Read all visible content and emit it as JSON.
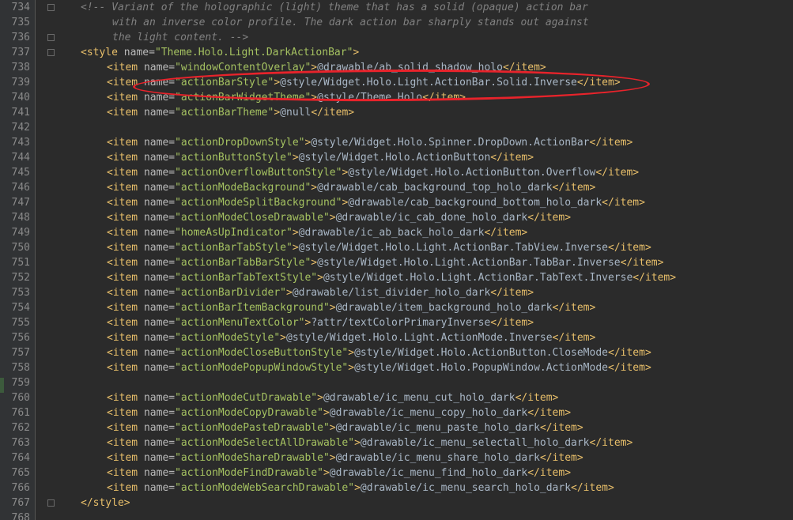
{
  "editor": {
    "annotation_color": "#e8232b",
    "lines": [
      {
        "no": "734",
        "indent": "comment",
        "fold": true,
        "segments": [
          {
            "t": "c",
            "v": "<!-- Variant of the holographic (light) theme that has a solid (opaque) action bar"
          }
        ]
      },
      {
        "no": "735",
        "indent": "comment2",
        "fold": false,
        "segments": [
          {
            "t": "c",
            "v": "with an inverse color profile. The dark action bar sharply stands out against"
          }
        ]
      },
      {
        "no": "736",
        "indent": "comment2",
        "fold": true,
        "segments": [
          {
            "t": "c",
            "v": "the light content. -->"
          }
        ]
      },
      {
        "no": "737",
        "indent": "style",
        "fold": true,
        "segments": [
          {
            "t": "tag",
            "v": "<style"
          },
          {
            "t": "attr",
            "v": " name="
          },
          {
            "t": "val",
            "v": "\"Theme.Holo.Light.DarkActionBar\""
          },
          {
            "t": "tag",
            "v": ">"
          }
        ]
      },
      {
        "no": "738",
        "indent": "item",
        "fold": false,
        "segments": [
          {
            "t": "tag",
            "v": "<item"
          },
          {
            "t": "attr",
            "v": " name="
          },
          {
            "t": "val",
            "v": "\"windowContentOverlay\""
          },
          {
            "t": "tag",
            "v": ">"
          },
          {
            "t": "txt",
            "v": "@drawable/ab_solid_shadow_holo"
          },
          {
            "t": "tag",
            "v": "</item>"
          }
        ]
      },
      {
        "no": "739",
        "indent": "item",
        "fold": false,
        "segments": [
          {
            "t": "tag",
            "v": "<item"
          },
          {
            "t": "attr",
            "v": " name="
          },
          {
            "t": "val",
            "v": "\"actionBarStyle\""
          },
          {
            "t": "tag",
            "v": ">"
          },
          {
            "t": "txt",
            "v": "@style/Widget.Holo.Light.ActionBar.Solid.Inverse"
          },
          {
            "t": "tag",
            "v": "</item>"
          }
        ]
      },
      {
        "no": "740",
        "indent": "item",
        "fold": false,
        "segments": [
          {
            "t": "tag",
            "v": "<item"
          },
          {
            "t": "attr",
            "v": " name="
          },
          {
            "t": "val",
            "v": "\"actionBarWidgetTheme\""
          },
          {
            "t": "tag",
            "v": ">"
          },
          {
            "t": "txt",
            "v": "@style/Theme.Holo"
          },
          {
            "t": "tag",
            "v": "</item>"
          }
        ]
      },
      {
        "no": "741",
        "indent": "item",
        "fold": false,
        "segments": [
          {
            "t": "tag",
            "v": "<item"
          },
          {
            "t": "attr",
            "v": " name="
          },
          {
            "t": "val",
            "v": "\"actionBarTheme\""
          },
          {
            "t": "tag",
            "v": ">"
          },
          {
            "t": "txt",
            "v": "@null"
          },
          {
            "t": "tag",
            "v": "</item>"
          }
        ]
      },
      {
        "no": "742",
        "indent": "item",
        "fold": false,
        "segments": []
      },
      {
        "no": "743",
        "indent": "item",
        "fold": false,
        "segments": [
          {
            "t": "tag",
            "v": "<item"
          },
          {
            "t": "attr",
            "v": " name="
          },
          {
            "t": "val",
            "v": "\"actionDropDownStyle\""
          },
          {
            "t": "tag",
            "v": ">"
          },
          {
            "t": "txt",
            "v": "@style/Widget.Holo.Spinner.DropDown.ActionBar"
          },
          {
            "t": "tag",
            "v": "</item>"
          }
        ]
      },
      {
        "no": "744",
        "indent": "item",
        "fold": false,
        "segments": [
          {
            "t": "tag",
            "v": "<item"
          },
          {
            "t": "attr",
            "v": " name="
          },
          {
            "t": "val",
            "v": "\"actionButtonStyle\""
          },
          {
            "t": "tag",
            "v": ">"
          },
          {
            "t": "txt",
            "v": "@style/Widget.Holo.ActionButton"
          },
          {
            "t": "tag",
            "v": "</item>"
          }
        ]
      },
      {
        "no": "745",
        "indent": "item",
        "fold": false,
        "segments": [
          {
            "t": "tag",
            "v": "<item"
          },
          {
            "t": "attr",
            "v": " name="
          },
          {
            "t": "val",
            "v": "\"actionOverflowButtonStyle\""
          },
          {
            "t": "tag",
            "v": ">"
          },
          {
            "t": "txt",
            "v": "@style/Widget.Holo.ActionButton.Overflow"
          },
          {
            "t": "tag",
            "v": "</item>"
          }
        ]
      },
      {
        "no": "746",
        "indent": "item",
        "fold": false,
        "segments": [
          {
            "t": "tag",
            "v": "<item"
          },
          {
            "t": "attr",
            "v": " name="
          },
          {
            "t": "val",
            "v": "\"actionModeBackground\""
          },
          {
            "t": "tag",
            "v": ">"
          },
          {
            "t": "txt",
            "v": "@drawable/cab_background_top_holo_dark"
          },
          {
            "t": "tag",
            "v": "</item>"
          }
        ]
      },
      {
        "no": "747",
        "indent": "item",
        "fold": false,
        "segments": [
          {
            "t": "tag",
            "v": "<item"
          },
          {
            "t": "attr",
            "v": " name="
          },
          {
            "t": "val",
            "v": "\"actionModeSplitBackground\""
          },
          {
            "t": "tag",
            "v": ">"
          },
          {
            "t": "txt",
            "v": "@drawable/cab_background_bottom_holo_dark"
          },
          {
            "t": "tag",
            "v": "</item>"
          }
        ]
      },
      {
        "no": "748",
        "indent": "item",
        "fold": false,
        "segments": [
          {
            "t": "tag",
            "v": "<item"
          },
          {
            "t": "attr",
            "v": " name="
          },
          {
            "t": "val",
            "v": "\"actionModeCloseDrawable\""
          },
          {
            "t": "tag",
            "v": ">"
          },
          {
            "t": "txt",
            "v": "@drawable/ic_cab_done_holo_dark"
          },
          {
            "t": "tag",
            "v": "</item>"
          }
        ]
      },
      {
        "no": "749",
        "indent": "item",
        "fold": false,
        "segments": [
          {
            "t": "tag",
            "v": "<item"
          },
          {
            "t": "attr",
            "v": " name="
          },
          {
            "t": "val",
            "v": "\"homeAsUpIndicator\""
          },
          {
            "t": "tag",
            "v": ">"
          },
          {
            "t": "txt",
            "v": "@drawable/ic_ab_back_holo_dark"
          },
          {
            "t": "tag",
            "v": "</item>"
          }
        ]
      },
      {
        "no": "750",
        "indent": "item",
        "fold": false,
        "segments": [
          {
            "t": "tag",
            "v": "<item"
          },
          {
            "t": "attr",
            "v": " name="
          },
          {
            "t": "val",
            "v": "\"actionBarTabStyle\""
          },
          {
            "t": "tag",
            "v": ">"
          },
          {
            "t": "txt",
            "v": "@style/Widget.Holo.Light.ActionBar.TabView.Inverse"
          },
          {
            "t": "tag",
            "v": "</item>"
          }
        ]
      },
      {
        "no": "751",
        "indent": "item",
        "fold": false,
        "segments": [
          {
            "t": "tag",
            "v": "<item"
          },
          {
            "t": "attr",
            "v": " name="
          },
          {
            "t": "val",
            "v": "\"actionBarTabBarStyle\""
          },
          {
            "t": "tag",
            "v": ">"
          },
          {
            "t": "txt",
            "v": "@style/Widget.Holo.Light.ActionBar.TabBar.Inverse"
          },
          {
            "t": "tag",
            "v": "</item>"
          }
        ]
      },
      {
        "no": "752",
        "indent": "item",
        "fold": false,
        "segments": [
          {
            "t": "tag",
            "v": "<item"
          },
          {
            "t": "attr",
            "v": " name="
          },
          {
            "t": "val",
            "v": "\"actionBarTabTextStyle\""
          },
          {
            "t": "tag",
            "v": ">"
          },
          {
            "t": "txt",
            "v": "@style/Widget.Holo.Light.ActionBar.TabText.Inverse"
          },
          {
            "t": "tag",
            "v": "</item>"
          }
        ]
      },
      {
        "no": "753",
        "indent": "item",
        "fold": false,
        "segments": [
          {
            "t": "tag",
            "v": "<item"
          },
          {
            "t": "attr",
            "v": " name="
          },
          {
            "t": "val",
            "v": "\"actionBarDivider\""
          },
          {
            "t": "tag",
            "v": ">"
          },
          {
            "t": "txt",
            "v": "@drawable/list_divider_holo_dark"
          },
          {
            "t": "tag",
            "v": "</item>"
          }
        ]
      },
      {
        "no": "754",
        "indent": "item",
        "fold": false,
        "segments": [
          {
            "t": "tag",
            "v": "<item"
          },
          {
            "t": "attr",
            "v": " name="
          },
          {
            "t": "val",
            "v": "\"actionBarItemBackground\""
          },
          {
            "t": "tag",
            "v": ">"
          },
          {
            "t": "txt",
            "v": "@drawable/item_background_holo_dark"
          },
          {
            "t": "tag",
            "v": "</item>"
          }
        ]
      },
      {
        "no": "755",
        "indent": "item",
        "fold": false,
        "segments": [
          {
            "t": "tag",
            "v": "<item"
          },
          {
            "t": "attr",
            "v": " name="
          },
          {
            "t": "val",
            "v": "\"actionMenuTextColor\""
          },
          {
            "t": "tag",
            "v": ">"
          },
          {
            "t": "txt",
            "v": "?attr/textColorPrimaryInverse"
          },
          {
            "t": "tag",
            "v": "</item>"
          }
        ]
      },
      {
        "no": "756",
        "indent": "item",
        "fold": false,
        "segments": [
          {
            "t": "tag",
            "v": "<item"
          },
          {
            "t": "attr",
            "v": " name="
          },
          {
            "t": "val",
            "v": "\"actionModeStyle\""
          },
          {
            "t": "tag",
            "v": ">"
          },
          {
            "t": "txt",
            "v": "@style/Widget.Holo.Light.ActionMode.Inverse"
          },
          {
            "t": "tag",
            "v": "</item>"
          }
        ]
      },
      {
        "no": "757",
        "indent": "item",
        "fold": false,
        "segments": [
          {
            "t": "tag",
            "v": "<item"
          },
          {
            "t": "attr",
            "v": " name="
          },
          {
            "t": "val",
            "v": "\"actionModeCloseButtonStyle\""
          },
          {
            "t": "tag",
            "v": ">"
          },
          {
            "t": "txt",
            "v": "@style/Widget.Holo.ActionButton.CloseMode"
          },
          {
            "t": "tag",
            "v": "</item>"
          }
        ]
      },
      {
        "no": "758",
        "indent": "item",
        "fold": false,
        "segments": [
          {
            "t": "tag",
            "v": "<item"
          },
          {
            "t": "attr",
            "v": " name="
          },
          {
            "t": "val",
            "v": "\"actionModePopupWindowStyle\""
          },
          {
            "t": "tag",
            "v": ">"
          },
          {
            "t": "txt",
            "v": "@style/Widget.Holo.PopupWindow.ActionMode"
          },
          {
            "t": "tag",
            "v": "</item>"
          }
        ]
      },
      {
        "no": "759",
        "indent": "item",
        "fold": false,
        "segments": []
      },
      {
        "no": "760",
        "indent": "item",
        "fold": false,
        "segments": [
          {
            "t": "tag",
            "v": "<item"
          },
          {
            "t": "attr",
            "v": " name="
          },
          {
            "t": "val",
            "v": "\"actionModeCutDrawable\""
          },
          {
            "t": "tag",
            "v": ">"
          },
          {
            "t": "txt",
            "v": "@drawable/ic_menu_cut_holo_dark"
          },
          {
            "t": "tag",
            "v": "</item>"
          }
        ]
      },
      {
        "no": "761",
        "indent": "item",
        "fold": false,
        "segments": [
          {
            "t": "tag",
            "v": "<item"
          },
          {
            "t": "attr",
            "v": " name="
          },
          {
            "t": "val",
            "v": "\"actionModeCopyDrawable\""
          },
          {
            "t": "tag",
            "v": ">"
          },
          {
            "t": "txt",
            "v": "@drawable/ic_menu_copy_holo_dark"
          },
          {
            "t": "tag",
            "v": "</item>"
          }
        ]
      },
      {
        "no": "762",
        "indent": "item",
        "fold": false,
        "segments": [
          {
            "t": "tag",
            "v": "<item"
          },
          {
            "t": "attr",
            "v": " name="
          },
          {
            "t": "val",
            "v": "\"actionModePasteDrawable\""
          },
          {
            "t": "tag",
            "v": ">"
          },
          {
            "t": "txt",
            "v": "@drawable/ic_menu_paste_holo_dark"
          },
          {
            "t": "tag",
            "v": "</item>"
          }
        ]
      },
      {
        "no": "763",
        "indent": "item",
        "fold": false,
        "segments": [
          {
            "t": "tag",
            "v": "<item"
          },
          {
            "t": "attr",
            "v": " name="
          },
          {
            "t": "val",
            "v": "\"actionModeSelectAllDrawable\""
          },
          {
            "t": "tag",
            "v": ">"
          },
          {
            "t": "txt",
            "v": "@drawable/ic_menu_selectall_holo_dark"
          },
          {
            "t": "tag",
            "v": "</item>"
          }
        ]
      },
      {
        "no": "764",
        "indent": "item",
        "fold": false,
        "segments": [
          {
            "t": "tag",
            "v": "<item"
          },
          {
            "t": "attr",
            "v": " name="
          },
          {
            "t": "val",
            "v": "\"actionModeShareDrawable\""
          },
          {
            "t": "tag",
            "v": ">"
          },
          {
            "t": "txt",
            "v": "@drawable/ic_menu_share_holo_dark"
          },
          {
            "t": "tag",
            "v": "</item>"
          }
        ]
      },
      {
        "no": "765",
        "indent": "item",
        "fold": false,
        "segments": [
          {
            "t": "tag",
            "v": "<item"
          },
          {
            "t": "attr",
            "v": " name="
          },
          {
            "t": "val",
            "v": "\"actionModeFindDrawable\""
          },
          {
            "t": "tag",
            "v": ">"
          },
          {
            "t": "txt",
            "v": "@drawable/ic_menu_find_holo_dark"
          },
          {
            "t": "tag",
            "v": "</item>"
          }
        ]
      },
      {
        "no": "766",
        "indent": "item",
        "fold": false,
        "segments": [
          {
            "t": "tag",
            "v": "<item"
          },
          {
            "t": "attr",
            "v": " name="
          },
          {
            "t": "val",
            "v": "\"actionModeWebSearchDrawable\""
          },
          {
            "t": "tag",
            "v": ">"
          },
          {
            "t": "txt",
            "v": "@drawable/ic_menu_search_holo_dark"
          },
          {
            "t": "tag",
            "v": "</item>"
          }
        ]
      },
      {
        "no": "767",
        "indent": "style",
        "fold": true,
        "segments": [
          {
            "t": "tag",
            "v": "</style>"
          }
        ]
      },
      {
        "no": "768",
        "indent": "item",
        "fold": false,
        "segments": []
      }
    ]
  }
}
